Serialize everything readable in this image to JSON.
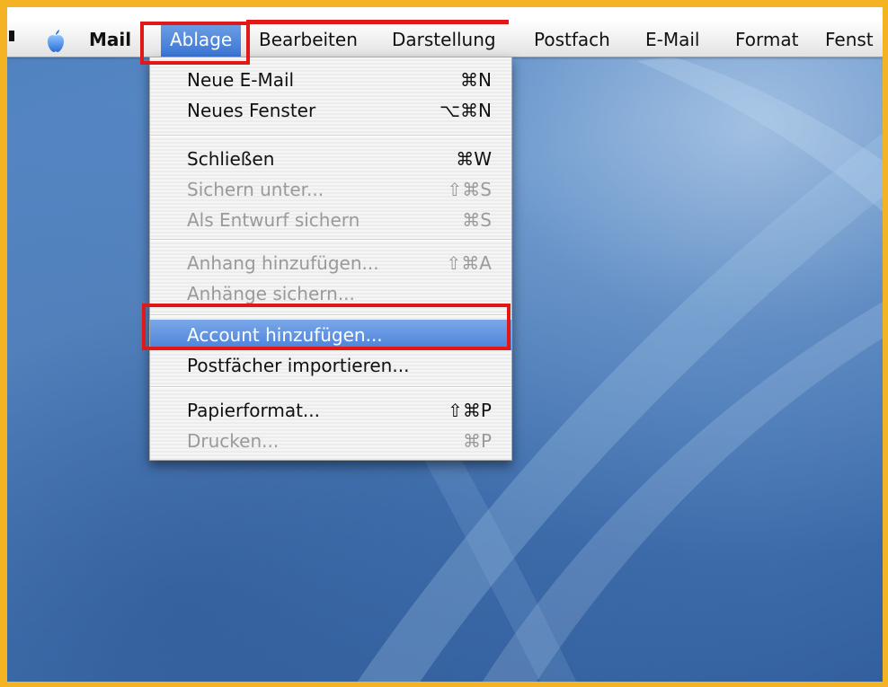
{
  "menubar": {
    "apple_icon": "apple-logo-icon",
    "app_name": "Mail",
    "menus": [
      "Ablage",
      "Bearbeiten",
      "Darstellung",
      "Postfach",
      "E-Mail",
      "Format",
      "Fenst"
    ]
  },
  "dropdown": {
    "items": [
      {
        "label": "Neue E-Mail",
        "shortcut": "⌘N",
        "enabled": true
      },
      {
        "label": "Neues Fenster",
        "shortcut": "⌥⌘N",
        "enabled": true
      },
      {
        "label": "Schließen",
        "shortcut": "⌘W",
        "enabled": true
      },
      {
        "label": "Sichern unter...",
        "shortcut": "⇧⌘S",
        "enabled": false
      },
      {
        "label": "Als Entwurf sichern",
        "shortcut": "⌘S",
        "enabled": false
      },
      {
        "label": "Anhang hinzufügen...",
        "shortcut": "⇧⌘A",
        "enabled": false
      },
      {
        "label": "Anhänge sichern...",
        "shortcut": "",
        "enabled": false
      },
      {
        "label": "Account hinzufügen...",
        "shortcut": "",
        "enabled": true,
        "highlighted": true
      },
      {
        "label": "Postfächer importieren...",
        "shortcut": "",
        "enabled": true
      },
      {
        "label": "Papierformat...",
        "shortcut": "⇧⌘P",
        "enabled": true
      },
      {
        "label": "Drucken...",
        "shortcut": "⌘P",
        "enabled": false
      }
    ]
  },
  "colors": {
    "frame_border": "#f3b323",
    "annotation_red": "#e01818",
    "highlight_blue": "#4a81d9",
    "desktop_blue": "#3b6cad"
  }
}
